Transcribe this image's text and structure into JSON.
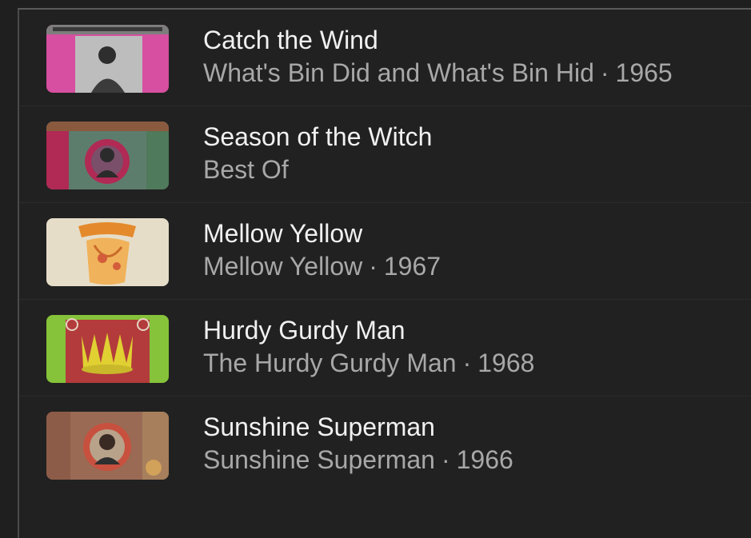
{
  "tracks": [
    {
      "title": "Catch the Wind",
      "album": "What's Bin Did and What's Bin Hid",
      "separator": "·",
      "year": "1965",
      "art_colors": {
        "bg": "#d64fa0",
        "center": "#bdbdbd"
      }
    },
    {
      "title": "Season of the Witch",
      "album": "Best Of",
      "separator": "",
      "year": "",
      "art_colors": {
        "bg": "#5d7d6c",
        "center": "#b02a55"
      }
    },
    {
      "title": "Mellow Yellow",
      "album": "Mellow Yellow",
      "separator": "·",
      "year": "1967",
      "art_colors": {
        "bg": "#e6ddc9",
        "center": "#e48a2c"
      }
    },
    {
      "title": "Hurdy Gurdy Man",
      "album": "The Hurdy Gurdy Man",
      "separator": "·",
      "year": "1968",
      "art_colors": {
        "bg": "#86c23a",
        "center": "#e0d032"
      }
    },
    {
      "title": "Sunshine Superman",
      "album": "Sunshine Superman",
      "separator": "·",
      "year": "1966",
      "art_colors": {
        "bg": "#9a6a55",
        "center": "#c7513e"
      }
    }
  ]
}
